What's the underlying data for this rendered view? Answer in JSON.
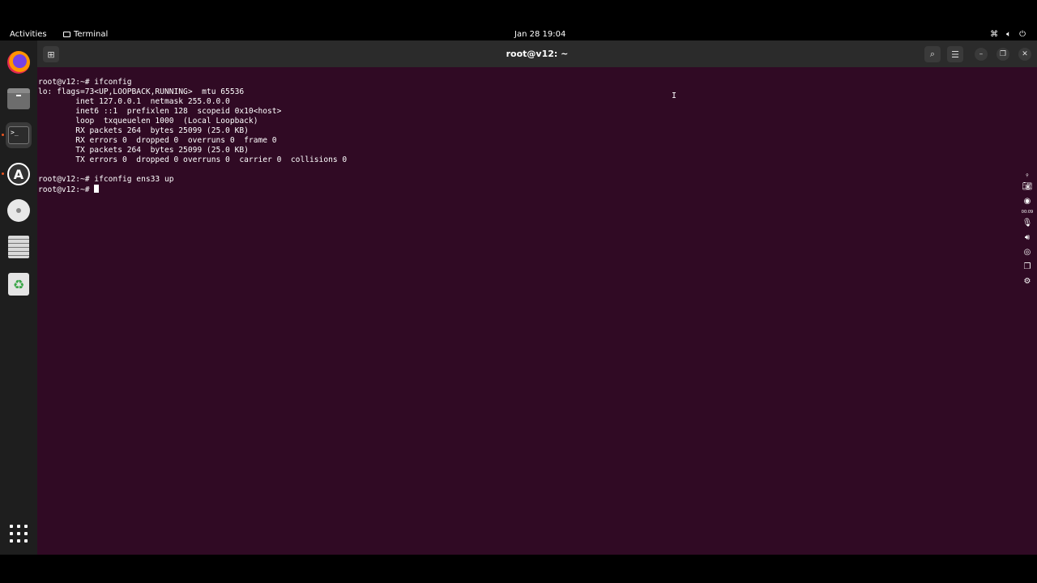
{
  "panel": {
    "activities": "Activities",
    "app_name": "Terminal",
    "clock": "Jan 28  19:04"
  },
  "dock": {
    "items": [
      "firefox",
      "files",
      "terminal",
      "app-center",
      "disc",
      "text-editor",
      "trash"
    ],
    "accent_color": "#e95420"
  },
  "window": {
    "title": "root@v12: ~",
    "background": "#300a24"
  },
  "terminal": {
    "lines": [
      "root@v12:~# ifconfig",
      "lo: flags=73<UP,LOOPBACK,RUNNING>  mtu 65536",
      "        inet 127.0.0.1  netmask 255.0.0.0",
      "        inet6 ::1  prefixlen 128  scopeid 0x10<host>",
      "        loop  txqueuelen 1000  (Local Loopback)",
      "        RX packets 264  bytes 25099 (25.0 KB)",
      "        RX errors 0  dropped 0  overruns 0  frame 0",
      "        TX packets 264  bytes 25099 (25.0 KB)",
      "        TX errors 0  dropped 0 overruns 0  carrier 0  collisions 0",
      "",
      "root@v12:~# ifconfig ens33 up"
    ],
    "prompt": "root@v12:~# "
  },
  "recorder": {
    "timer": "00:09"
  }
}
